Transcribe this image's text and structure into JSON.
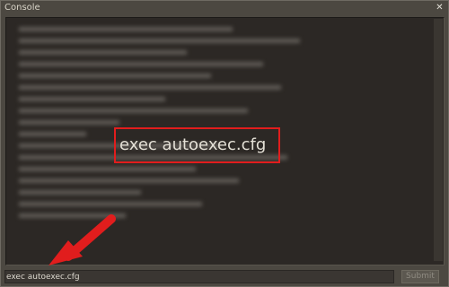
{
  "window": {
    "title": "Console"
  },
  "output": {
    "highlighted_command": "exec autoexec.cfg"
  },
  "input": {
    "value": "exec autoexec.cfg"
  },
  "submit": {
    "label": "Submit"
  },
  "colors": {
    "annotation": "#e11d1d",
    "background": "#4c4841",
    "output_bg": "#2c2825"
  }
}
